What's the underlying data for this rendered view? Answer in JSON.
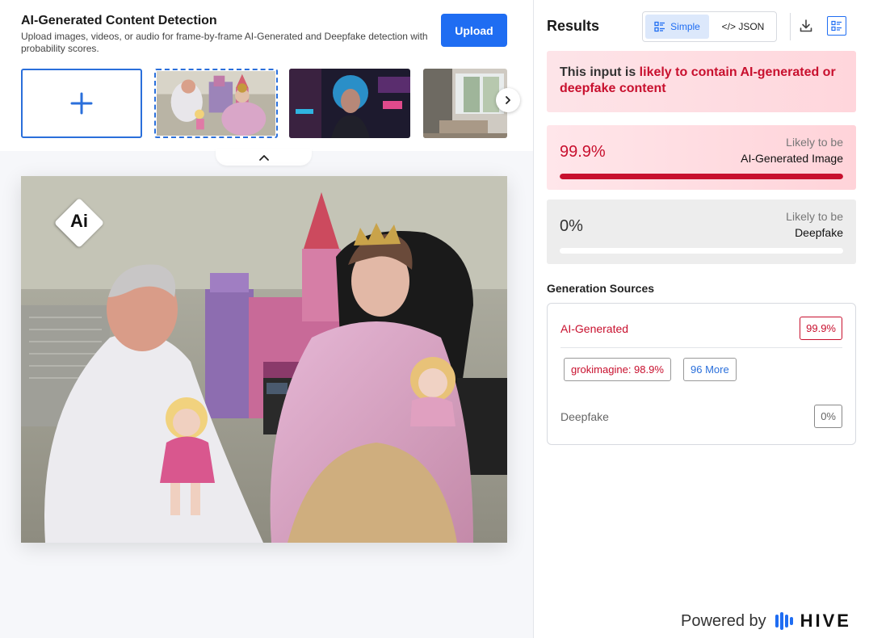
{
  "header": {
    "title": "AI-Generated Content Detection",
    "subtitle": "Upload images, videos, or audio for frame-by-frame AI-Generated and Deepfake detection with probability scores.",
    "upload_label": "Upload"
  },
  "thumbnails": [
    {
      "name": "thumbnail-castle-photo",
      "selected": true
    },
    {
      "name": "thumbnail-cyber-woman",
      "selected": false
    },
    {
      "name": "thumbnail-interior",
      "selected": false
    }
  ],
  "image_badge": {
    "text": "Ai"
  },
  "results": {
    "title": "Results",
    "view_simple": "Simple",
    "view_json": "</> JSON",
    "verdict_prefix": "This input is ",
    "verdict_highlight": "likely to contain AI-generated or deepfake content",
    "ai_score": {
      "value": "99.9%",
      "fraction": 0.999,
      "line1": "Likely to be",
      "line2": "AI-Generated Image"
    },
    "deepfake_score": {
      "value": "0%",
      "fraction": 0.0,
      "line1": "Likely to be",
      "line2": "Deepfake"
    }
  },
  "generation_sources": {
    "title": "Generation Sources",
    "ai_label": "AI-Generated",
    "ai_pct": "99.9%",
    "source_chip": "grokimagine: 98.9%",
    "more_chip": "96 More",
    "deepfake_label": "Deepfake",
    "deepfake_pct": "0%"
  },
  "footer": {
    "powered_by": "Powered by",
    "brand": "HIVE"
  },
  "colors": {
    "accent": "#1f6df2",
    "danger": "#c8102e"
  }
}
